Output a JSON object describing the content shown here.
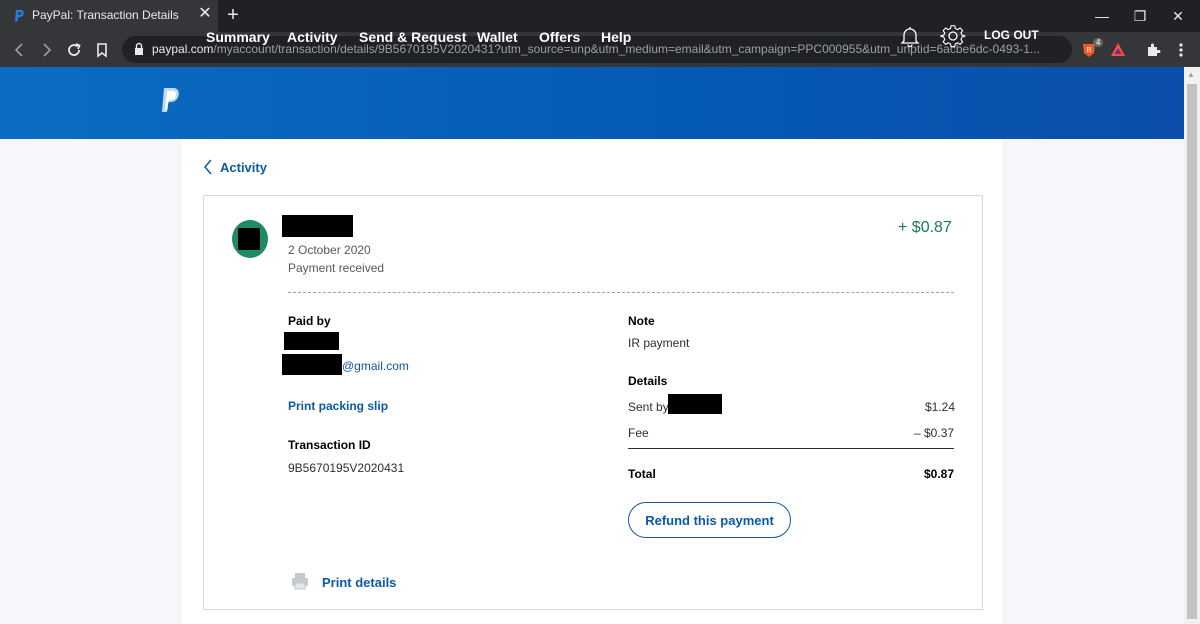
{
  "browser": {
    "tab_title": "PayPal: Transaction Details",
    "tab_close_glyph": "✕",
    "new_tab_glyph": "+",
    "window_minimize": "—",
    "window_restore": "❐",
    "window_close": "✕",
    "url_host": "paypal.com",
    "url_path": "/myaccount/transaction/details/9B5670195V2020431?utm_source=unp&utm_medium=email&utm_campaign=PPC000955&utm_unptid=6acbe6dc-0493-1...",
    "brave_badge": "4"
  },
  "header": {
    "nav": [
      "Summary",
      "Activity",
      "Send & Request",
      "Wallet",
      "Offers",
      "Help"
    ],
    "logout": "LOG OUT"
  },
  "page": {
    "back_label": "Activity"
  },
  "transaction": {
    "date": "2 October 2020",
    "status": "Payment received",
    "amount": "+ $0.87",
    "paid_by_label": "Paid by",
    "email_suffix": "@gmail.com",
    "print_packing_slip": "Print packing slip",
    "transaction_id_label": "Transaction ID",
    "transaction_id": "9B5670195V2020431",
    "note_label": "Note",
    "note": "IR payment",
    "details_label": "Details",
    "sent_by_label": "Sent by",
    "sent_by_amount": "$1.24",
    "fee_label": "Fee",
    "fee_amount": "– $0.37",
    "total_label": "Total",
    "total_amount": "$0.87",
    "refund_button": "Refund this payment",
    "print_details": "Print details"
  },
  "colors": {
    "header_blue": "#0559b3",
    "link_blue": "#0c5aa6",
    "amount_green": "#1c7a5a",
    "avatar_green": "#1f8a64"
  },
  "icons": [
    "paypal-favicon-icon",
    "lock-icon",
    "brave-icon",
    "bat-icon",
    "extensions-icon",
    "menu-icon",
    "paypal-logo-icon",
    "bell-icon",
    "gear-icon",
    "chevron-left-icon",
    "printer-icon"
  ]
}
